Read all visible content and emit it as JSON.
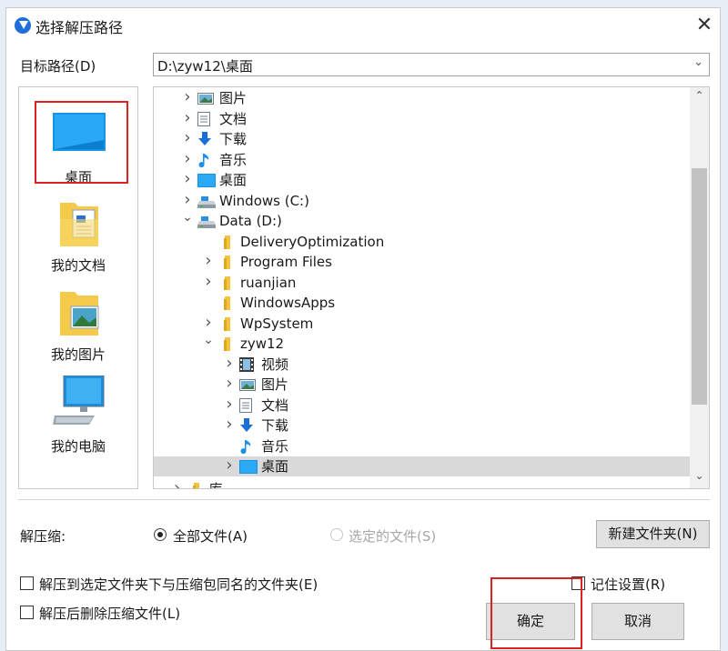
{
  "window": {
    "title": "选择解压路径"
  },
  "path": {
    "label": "目标路径(D)",
    "value": "D:\\zyw12\\桌面"
  },
  "places": [
    {
      "label": "桌面",
      "icon": "desktop-icon"
    },
    {
      "label": "我的文档",
      "icon": "documents-folder-icon"
    },
    {
      "label": "我的图片",
      "icon": "pictures-folder-icon"
    },
    {
      "label": "我的电脑",
      "icon": "computer-icon"
    }
  ],
  "tree": {
    "nodes": [
      {
        "label": "图片",
        "icon": "pictures-icon",
        "expand": "›"
      },
      {
        "label": "文档",
        "icon": "document-icon",
        "expand": "›"
      },
      {
        "label": "下载",
        "icon": "download-icon",
        "expand": "›"
      },
      {
        "label": "音乐",
        "icon": "music-icon",
        "expand": "›"
      },
      {
        "label": "桌面",
        "icon": "desktop-icon",
        "expand": "›"
      },
      {
        "label": "Windows (C:)",
        "icon": "drive-icon",
        "expand": "›"
      },
      {
        "label": "Data (D:)",
        "icon": "drive-icon",
        "expand": "⌄"
      },
      {
        "label": "DeliveryOptimization",
        "icon": "folder-icon",
        "expand": ""
      },
      {
        "label": "Program Files",
        "icon": "folder-icon",
        "expand": "›"
      },
      {
        "label": "ruanjian",
        "icon": "folder-icon",
        "expand": "›"
      },
      {
        "label": "WindowsApps",
        "icon": "folder-icon",
        "expand": ""
      },
      {
        "label": "WpSystem",
        "icon": "folder-icon",
        "expand": "›"
      },
      {
        "label": "zyw12",
        "icon": "folder-icon",
        "expand": "⌄"
      },
      {
        "label": "视频",
        "icon": "video-icon",
        "expand": "›"
      },
      {
        "label": "图片",
        "icon": "pictures-icon",
        "expand": "›"
      },
      {
        "label": "文档",
        "icon": "document-icon",
        "expand": "›"
      },
      {
        "label": "下载",
        "icon": "download-icon",
        "expand": "›"
      },
      {
        "label": "音乐",
        "icon": "music-icon",
        "expand": ""
      },
      {
        "label": "桌面",
        "icon": "desktop-icon",
        "expand": "›",
        "selected": true
      },
      {
        "label": "库",
        "icon": "folder-icon",
        "expand": "›"
      }
    ]
  },
  "extract": {
    "label": "解压缩:",
    "all_files": "全部文件(A)",
    "selected_files": "选定的文件(S)",
    "new_folder": "新建文件夹(N)"
  },
  "options": {
    "extract_to_named_folder": "解压到选定文件夹下与压缩包同名的文件夹(E)",
    "delete_after": "解压后删除压缩文件(L)",
    "remember": "记住设置(R)"
  },
  "buttons": {
    "ok": "确定",
    "cancel": "取消"
  },
  "colors": {
    "accent": "#1e6fd9",
    "highlight": "#e02020",
    "selected_row": "#d9d9d9"
  }
}
